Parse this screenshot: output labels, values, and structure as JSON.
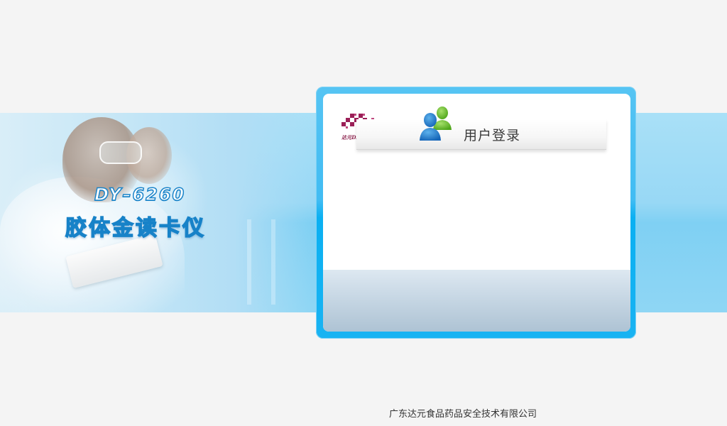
{
  "banner": {
    "product_model": "DY–6260",
    "product_name": "胶体金读卡仪"
  },
  "login_panel": {
    "brand_logo_text": "达元DAYUAN",
    "title": "用户登录",
    "users_icon": "users-group-icon"
  },
  "footer": {
    "company_name": "广东达元食品药品安全技术有限公司"
  },
  "colors": {
    "panel_border": "#3fbdf3",
    "banner": "#98d8f5",
    "brand": "#8a1f4a",
    "user_icon_blue": "#1f78c8",
    "user_icon_green": "#6cc12e"
  }
}
